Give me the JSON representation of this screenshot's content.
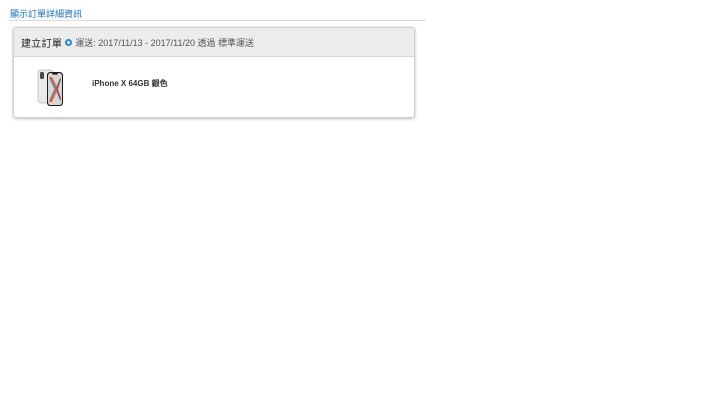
{
  "page": {
    "top_link": "顯示訂單詳細資訊"
  },
  "order": {
    "status": "建立訂單",
    "delivery_prefix": "運送:",
    "delivery_range": "2017/11/13 - 2017/11/20",
    "delivery_method": "透過 標準運送",
    "items": [
      {
        "name": "iPhone X 64GB 銀色",
        "image_icon": "iphone-x-silver"
      }
    ]
  },
  "colors": {
    "link": "#1a6fb5",
    "status_icon": "#1e88d2",
    "header_bg": "#ececec"
  }
}
